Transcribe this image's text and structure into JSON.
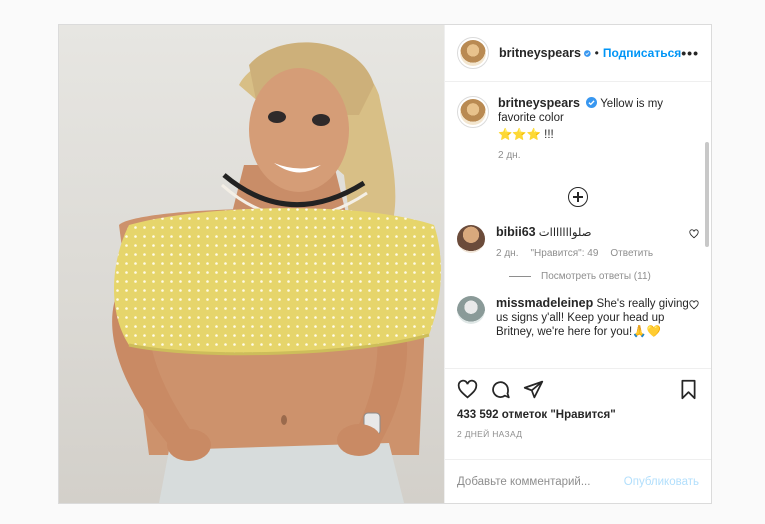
{
  "post": {
    "author": "britneyspears",
    "follow_label": "Подписаться",
    "more_label": "•••",
    "caption": {
      "username": "britneyspears",
      "text": "Yellow is my favorite color",
      "emojis": "⭐⭐⭐ !!!",
      "time": "2 дн."
    },
    "comments": [
      {
        "username": "bibii63",
        "text": "صلوااااااات",
        "time": "2 дн.",
        "likes": "\"Нравится\": 49",
        "reply_label": "Ответить",
        "view_replies": "Посмотреть ответы (11)"
      },
      {
        "username": "missmadeleinep",
        "text": "She's really giving us signs y'all! Keep your head up Britney, we're here for you!🙏💛"
      }
    ],
    "likes_text": "433 592 отметок \"Нравится\"",
    "posted_ago": "2 ДНЕЙ НАЗАД",
    "comment_placeholder": "Добавьте комментарий...",
    "publish_label": "Опубликовать"
  },
  "icons": [
    "verified-badge-icon",
    "heart-icon",
    "comment-icon",
    "share-icon",
    "bookmark-icon",
    "plus-circle-icon"
  ],
  "colors": {
    "link_blue": "#0095f6",
    "publish_disabled": "#b2dffc",
    "secondary_text": "#8e8e8e",
    "shirt_yellow": "#e9d86a"
  }
}
